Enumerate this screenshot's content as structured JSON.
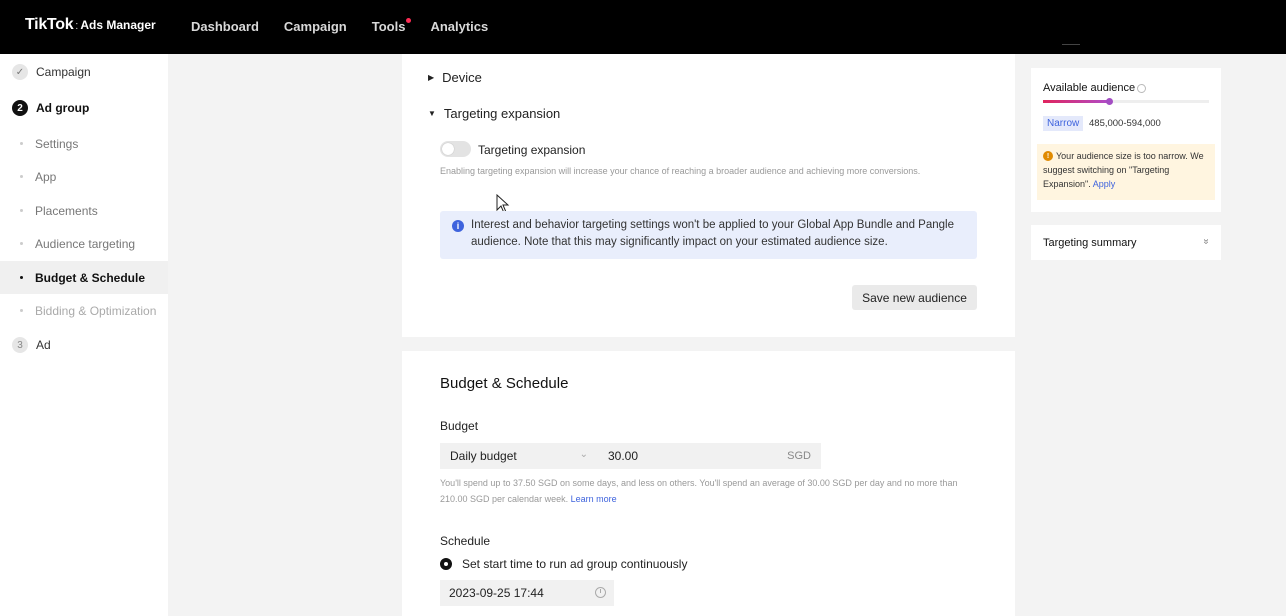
{
  "header": {
    "logo_main": "TikTok",
    "logo_sep": ":",
    "logo_sub": "Ads Manager",
    "nav": [
      "Dashboard",
      "Campaign",
      "Tools",
      "Analytics"
    ]
  },
  "sidebar": {
    "steps": [
      {
        "number": "✓",
        "label": "Campaign",
        "state": "done"
      },
      {
        "number": "2",
        "label": "Ad group",
        "state": "active"
      },
      {
        "number": "3",
        "label": "Ad",
        "state": "pending"
      }
    ],
    "sub_items": [
      "Settings",
      "App",
      "Placements",
      "Audience targeting",
      "Budget & Schedule",
      "Bidding & Optimization"
    ],
    "selected_sub": "Budget & Schedule"
  },
  "targeting": {
    "device_label": "Device",
    "expansion_section_label": "Targeting expansion",
    "toggle_label": "Targeting expansion",
    "toggle_on": false,
    "toggle_description": "Enabling targeting expansion will increase your chance of reaching a broader audience and achieving more conversions.",
    "notice": "Interest and behavior targeting settings won't be applied to your Global App Bundle and Pangle audience. Note that this may significantly impact on your estimated audience size.",
    "save_button": "Save new audience"
  },
  "budget_schedule": {
    "title": "Budget & Schedule",
    "budget_label": "Budget",
    "budget_type": "Daily budget",
    "budget_value": "30.00",
    "currency": "SGD",
    "budget_help": "You'll spend up to 37.50 SGD on some days, and less on others. You'll spend an average of 30.00 SGD per day and no more than 210.00 SGD per calendar week.",
    "learn_more": "Learn more",
    "schedule_label": "Schedule",
    "schedule_option": "Set start time to run ad group continuously",
    "start_time": "2023-09-25 17:44"
  },
  "audience": {
    "title": "Available audience",
    "level": 0.4,
    "status": "Narrow",
    "range": "485,000-594,000",
    "warning": "Your audience size is too narrow. We suggest switching on \"Targeting Expansion\".",
    "apply": "Apply"
  },
  "summary": {
    "title": "Targeting summary"
  }
}
